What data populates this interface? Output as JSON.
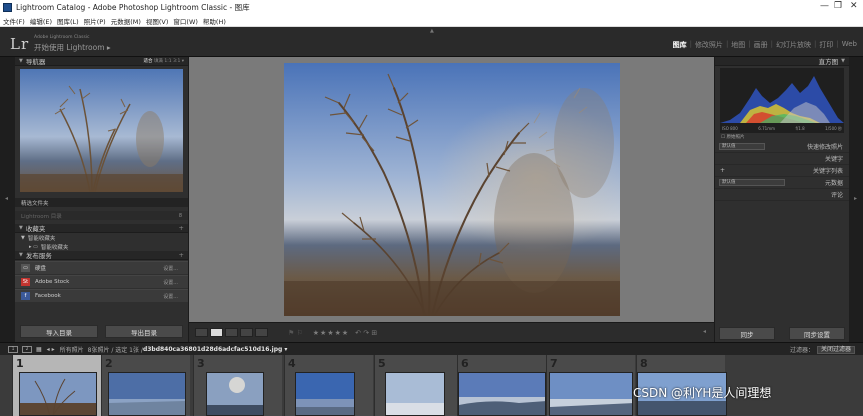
{
  "window": {
    "title": "Lightroom Catalog - Adobe Photoshop Lightroom Classic - 图库",
    "controls": [
      "—",
      "❐",
      "✕"
    ]
  },
  "menu": [
    "文件(F)",
    "编辑(E)",
    "图库(L)",
    "照片(P)",
    "元数据(M)",
    "视图(V)",
    "窗口(W)",
    "帮助(H)"
  ],
  "identity": {
    "logo": "Lr",
    "subtitle_small": "Adobe Lightroom Classic",
    "subtitle": "开始使用 Lightroom ▸"
  },
  "modules": [
    {
      "label": "图库",
      "active": true
    },
    {
      "label": "修改照片",
      "active": false
    },
    {
      "label": "地图",
      "active": false
    },
    {
      "label": "画册",
      "active": false
    },
    {
      "label": "幻灯片放映",
      "active": false
    },
    {
      "label": "打印",
      "active": false
    },
    {
      "label": "Web",
      "active": false
    }
  ],
  "navigator": {
    "title": "导航器",
    "options": [
      "适合",
      "填满",
      "1:1",
      "3:1 ▾"
    ]
  },
  "folders": {
    "smart_folder": "精选文件夹",
    "folder_row": "Lightroom 目录",
    "folder_count": "8",
    "collections_title": "收藏夹",
    "smart_collections": "智能收藏夹",
    "quick_collection": "智能收藏夹"
  },
  "publish": {
    "title": "发布服务",
    "services": [
      {
        "name": "硬盘",
        "badge": "▭",
        "color": "#555555",
        "tail": "设置..."
      },
      {
        "name": "Adobe Stock",
        "badge": "St",
        "color": "#c3342f",
        "tail": "设置..."
      },
      {
        "name": "Facebook",
        "badge": "f",
        "color": "#3b5998",
        "tail": "设置..."
      }
    ]
  },
  "left_buttons": {
    "import": "导入目录",
    "export": "导出目录"
  },
  "right_panel": {
    "histogram_title": "直方图",
    "hist_info": [
      "ISO 800",
      "6.71mm",
      "f/1.8",
      "1/500 秒"
    ],
    "original_photo": "原始照片",
    "quick_develop": {
      "preset": "默认值",
      "label": "快速修改照片"
    },
    "keywording": "关键字",
    "keyword_list": {
      "plus": "+",
      "label": "关键字列表"
    },
    "metadata": {
      "preset": "默认值",
      "label": "元数据"
    },
    "comments": "评论"
  },
  "right_buttons": {
    "sync": "同步",
    "sync_settings": "同步设置"
  },
  "toolbar": {
    "stars": "★★★★★",
    "misc": "↶ ↷ ⊞"
  },
  "filmstrip_bar": {
    "page1": "1",
    "page2": "2",
    "arrows": "◂ ▸",
    "source": "所有照片",
    "count": "8张照片 / 选定 1张 / ",
    "filename": "d3bd840ca36801d28d6adcfac510d16.jpg ▾",
    "filter_label": "过滤器：",
    "filter_value": "关闭过滤器"
  },
  "thumbnails": [
    {
      "num": "1",
      "selected": true
    },
    {
      "num": "2",
      "selected": false
    },
    {
      "num": "3",
      "selected": false
    },
    {
      "num": "4",
      "selected": false
    },
    {
      "num": "5",
      "selected": false
    },
    {
      "num": "6",
      "selected": false
    },
    {
      "num": "7",
      "selected": false
    },
    {
      "num": "8",
      "selected": false
    }
  ],
  "watermark": "CSDN @利YH是人间理想"
}
